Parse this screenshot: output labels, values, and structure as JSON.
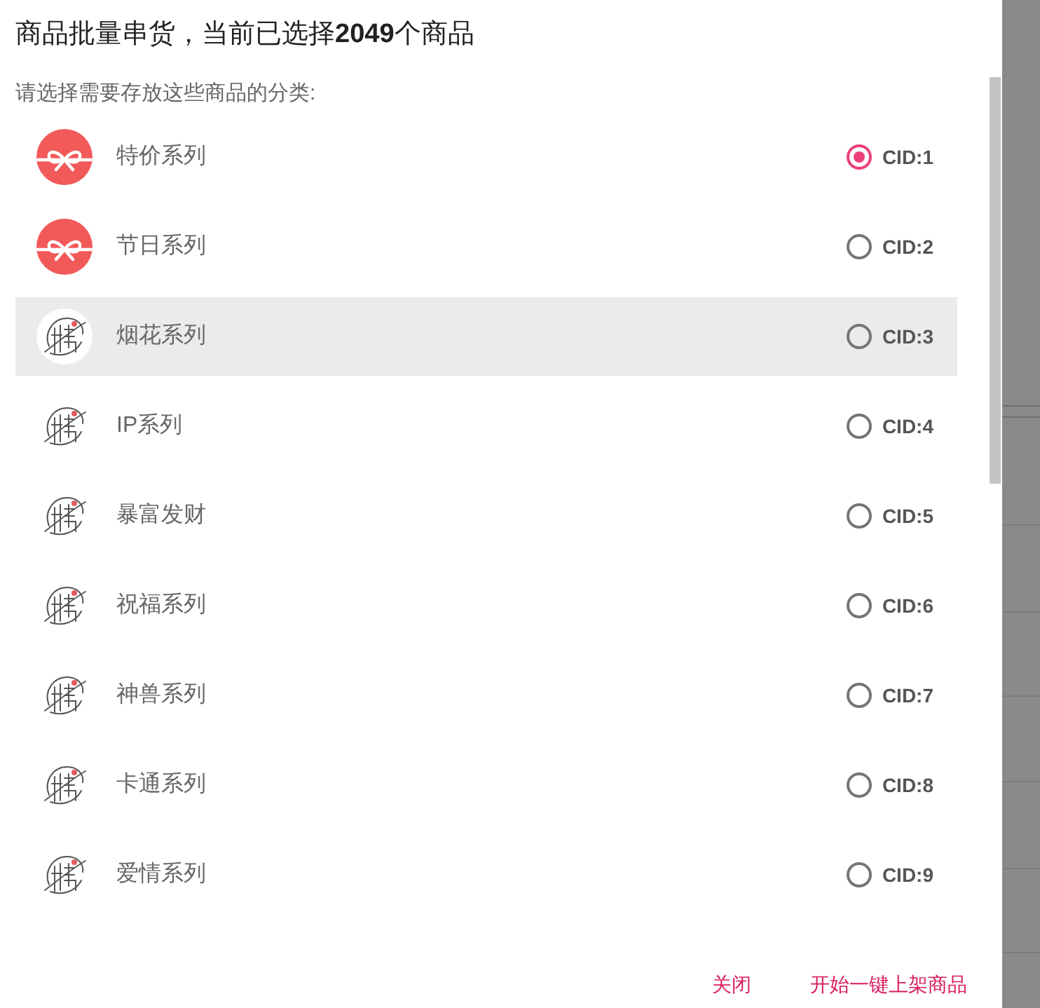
{
  "dialog": {
    "title": "商品批量串货，当前已选择**2049**个商品",
    "prompt": "请选择需要存放这些商品的分类:",
    "categories": [
      {
        "kind": "bow",
        "name": "特价系列",
        "cid": "CID:1",
        "selected": true,
        "highlighted": false
      },
      {
        "kind": "bow",
        "name": "节日系列",
        "cid": "CID:2",
        "selected": false,
        "highlighted": false
      },
      {
        "kind": "emblem",
        "name": "烟花系列",
        "cid": "CID:3",
        "selected": false,
        "highlighted": true
      },
      {
        "kind": "emblem",
        "name": "IP系列",
        "cid": "CID:4",
        "selected": false,
        "highlighted": false
      },
      {
        "kind": "emblem",
        "name": "暴富发财",
        "cid": "CID:5",
        "selected": false,
        "highlighted": false
      },
      {
        "kind": "emblem",
        "name": "祝福系列",
        "cid": "CID:6",
        "selected": false,
        "highlighted": false
      },
      {
        "kind": "emblem",
        "name": "神兽系列",
        "cid": "CID:7",
        "selected": false,
        "highlighted": false
      },
      {
        "kind": "emblem",
        "name": "卡通系列",
        "cid": "CID:8",
        "selected": false,
        "highlighted": false
      },
      {
        "kind": "emblem",
        "name": "爱情系列",
        "cid": "CID:9",
        "selected": false,
        "highlighted": false
      }
    ],
    "buttons": [
      {
        "label": "关闭"
      },
      {
        "label": "开始一键上架商品"
      }
    ]
  }
}
